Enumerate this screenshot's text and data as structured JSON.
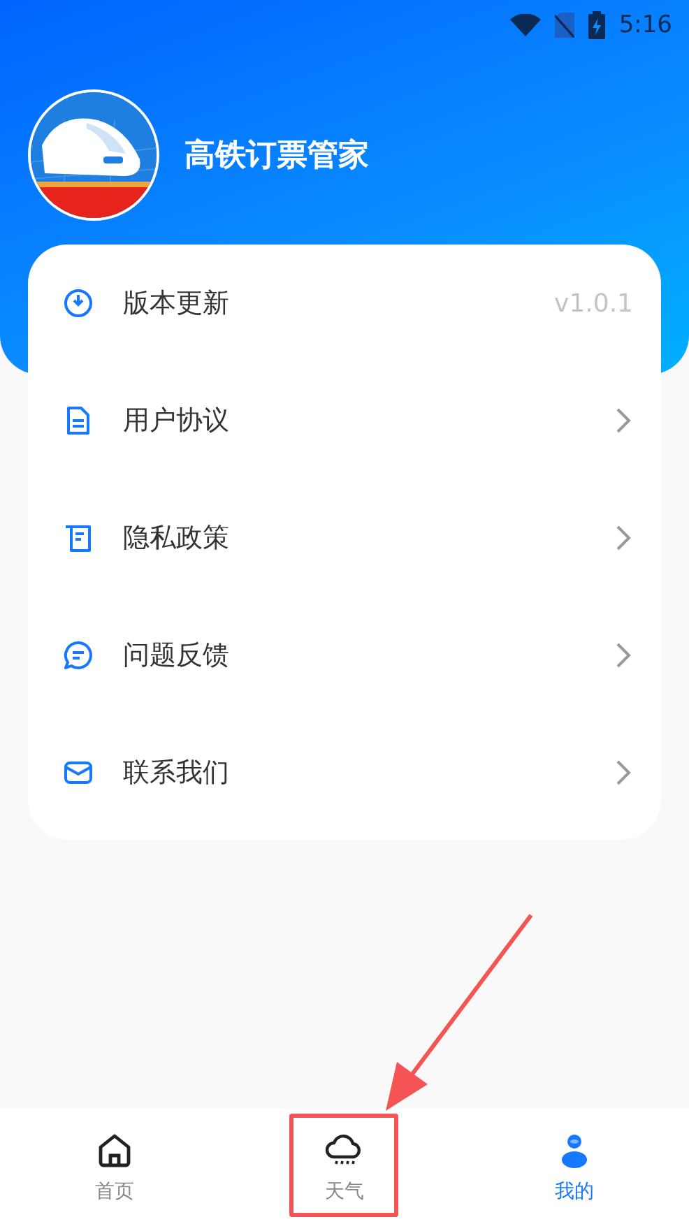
{
  "status_bar": {
    "time": "5:16"
  },
  "header": {
    "app_name": "高铁订票管家"
  },
  "menu": [
    {
      "label": "版本更新",
      "kind": "value",
      "value": "v1.0.1"
    },
    {
      "label": "用户协议",
      "kind": "link"
    },
    {
      "label": "隐私政策",
      "kind": "link"
    },
    {
      "label": "问题反馈",
      "kind": "link"
    },
    {
      "label": "联系我们",
      "kind": "link"
    }
  ],
  "bottom_nav": [
    {
      "label": "首页",
      "selected": false,
      "annotated": false
    },
    {
      "label": "天气",
      "selected": false,
      "annotated": true
    },
    {
      "label": "我的",
      "selected": true,
      "annotated": false
    }
  ]
}
